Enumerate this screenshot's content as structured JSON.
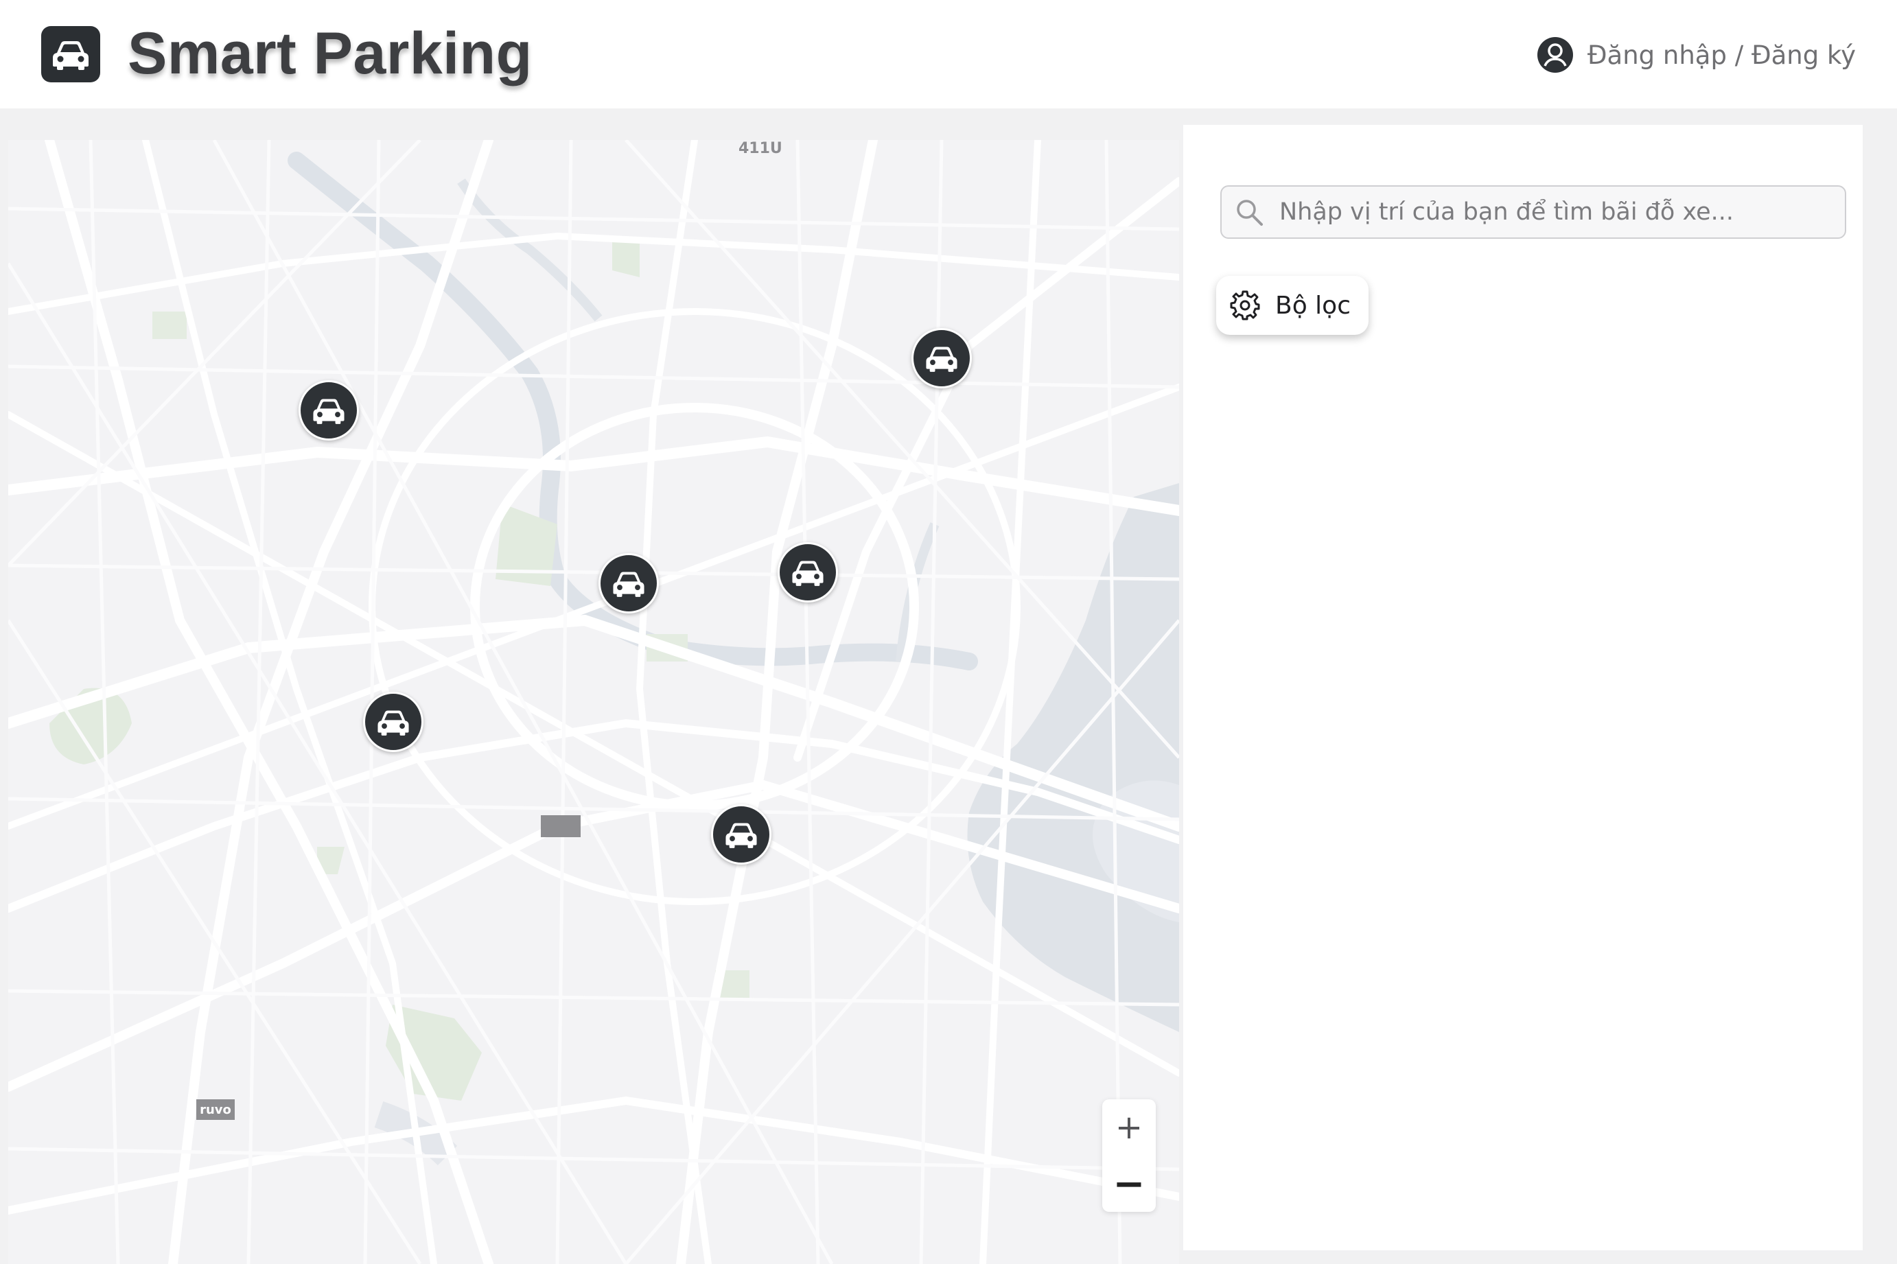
{
  "header": {
    "app_title": "Smart Parking",
    "login_label": "Đăng nhập / Đăng ký"
  },
  "search": {
    "placeholder": "Nhập vị trí của bạn để tìm bãi đỗ xe..."
  },
  "filter": {
    "label": "Bộ lọc"
  },
  "map": {
    "labels": {
      "top": "411U",
      "tag_bottom": "ruvo"
    },
    "pins": [
      {
        "name": "parking-pin-1",
        "icon": "car-icon"
      },
      {
        "name": "parking-pin-2",
        "icon": "car-icon"
      },
      {
        "name": "parking-pin-3",
        "icon": "car-icon"
      },
      {
        "name": "parking-pin-4",
        "icon": "car-icon"
      },
      {
        "name": "parking-pin-5",
        "icon": "car-icon"
      },
      {
        "name": "parking-pin-6",
        "icon": "car-icon"
      },
      {
        "name": "parking-pin-7",
        "icon": "car-icon"
      }
    ],
    "zoom": {
      "in": "+",
      "out": "−"
    }
  },
  "colors": {
    "brand_dark": "#2b2f33",
    "title_text": "#3e3f42",
    "map_background": "#f3f3f5",
    "water": "#dfe3e8",
    "park": "#e2ebdf"
  }
}
